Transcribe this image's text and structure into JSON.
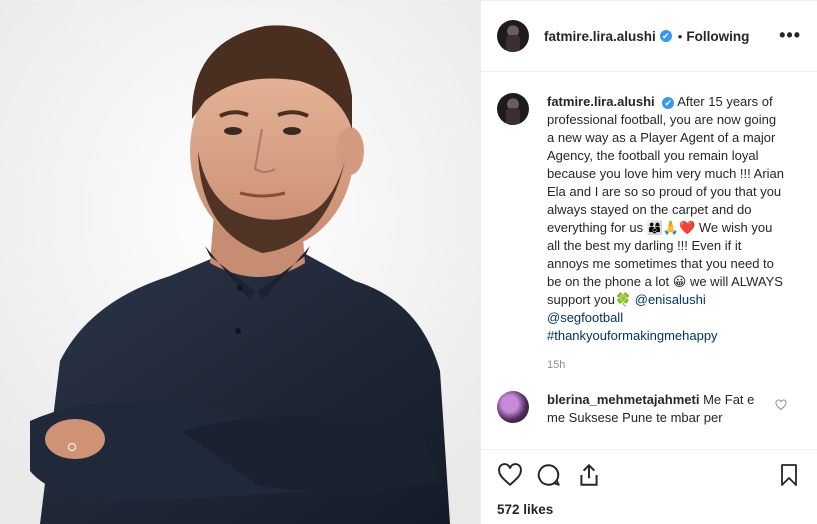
{
  "header": {
    "username": "fatmire.lira.alushi",
    "verified_mark": "✔",
    "separator": "•",
    "follow_status": "Following",
    "more_label": "•••"
  },
  "caption": {
    "username": "fatmire.lira.alushi",
    "text_1": "After 15 years of professional football, you are now going a new way as a Player Agent of a major Agency, the football you remain loyal because you love him very much !!! Arian Ela and I are so so proud of you that you always stayed on the carpet and do everything for us ",
    "emoji_1": "👨‍👩‍👦🙏❤️",
    "text_2": " We wish you all the best my darling !!! Even if it annoys me sometimes that you need to be on the phone a lot ",
    "emoji_2": "😀",
    "text_3": " we will ALWAYS support you",
    "emoji_3": "🍀",
    "mention_1": "@enisalushi",
    "mention_2": "@segfootball",
    "hashtag": "#thankyouformakingmehappy",
    "time": "15h"
  },
  "comment": {
    "username": "blerina_mehmetajahmeti",
    "text": "Me Fat e me Suksese Pune te mbar per"
  },
  "footer": {
    "likes": "572 likes"
  },
  "icons": {
    "like": "heart-icon",
    "comment": "comment-icon",
    "share": "share-icon",
    "save": "bookmark-icon",
    "more": "more-icon",
    "comment_like": "heart-icon"
  },
  "colors": {
    "link": "#003569",
    "verified": "#3897f0",
    "muted": "#8e8e8e",
    "text": "#262626"
  }
}
